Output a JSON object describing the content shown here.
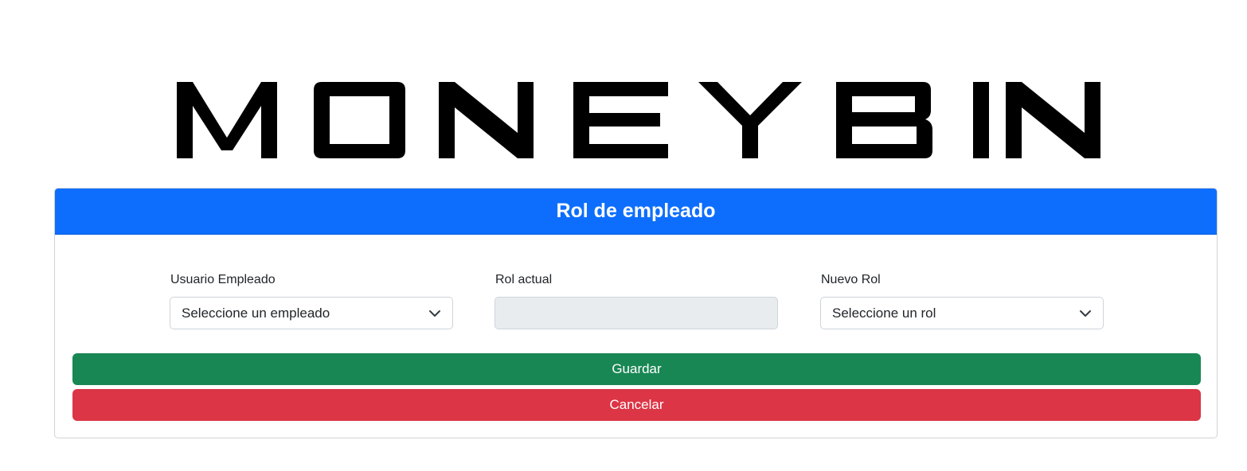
{
  "logo": {
    "text": "MONEY BIN"
  },
  "card": {
    "title": "Rol de empleado"
  },
  "form": {
    "employee": {
      "label": "Usuario Empleado",
      "value": "Seleccione un empleado"
    },
    "current_role": {
      "label": "Rol actual",
      "value": ""
    },
    "new_role": {
      "label": "Nuevo Rol",
      "value": "Seleccione un rol"
    }
  },
  "actions": {
    "save_label": "Guardar",
    "cancel_label": "Cancelar"
  },
  "colors": {
    "header": "#0d6efd",
    "save": "#198754",
    "cancel": "#dc3545",
    "readonly": "#e9ecef"
  },
  "icons": {
    "select_arrow": "chevron-down-icon"
  }
}
